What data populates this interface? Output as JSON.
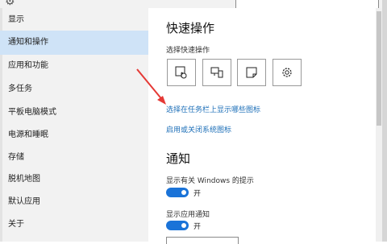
{
  "window": {
    "top_icon": "gear-icon",
    "search_placeholder": ""
  },
  "sidebar": {
    "items": [
      {
        "label": "显示",
        "active": false
      },
      {
        "label": "通知和操作",
        "active": true
      },
      {
        "label": "应用和功能",
        "active": false
      },
      {
        "label": "多任务",
        "active": false
      },
      {
        "label": "平板电脑模式",
        "active": false
      },
      {
        "label": "电源和睡眠",
        "active": false
      },
      {
        "label": "存储",
        "active": false
      },
      {
        "label": "脱机地图",
        "active": false
      },
      {
        "label": "默认应用",
        "active": false
      },
      {
        "label": "关于",
        "active": false
      }
    ]
  },
  "main": {
    "quick_actions": {
      "title": "快速操作",
      "subtitle": "选择快速操作",
      "buttons": [
        {
          "icon": "tablet-mode-icon"
        },
        {
          "icon": "connect-display-icon"
        },
        {
          "icon": "note-icon"
        },
        {
          "icon": "settings-gear-icon"
        }
      ]
    },
    "links": {
      "taskbar_icons": "选择在任务栏上显示哪些图标",
      "system_icons": "启用或关闭系统图标"
    },
    "notifications": {
      "title": "通知",
      "windows_tips_label": "显示有关 Windows 的提示",
      "windows_tips_state": "开",
      "app_notifications_label": "显示应用通知",
      "app_notifications_state": "开"
    }
  },
  "colors": {
    "accent": "#1a73d8",
    "link": "#1d6fb8",
    "sidebar_bg": "#f2f2f2",
    "sidebar_active": "#cfe3f7",
    "annotation_arrow": "#e53935"
  }
}
